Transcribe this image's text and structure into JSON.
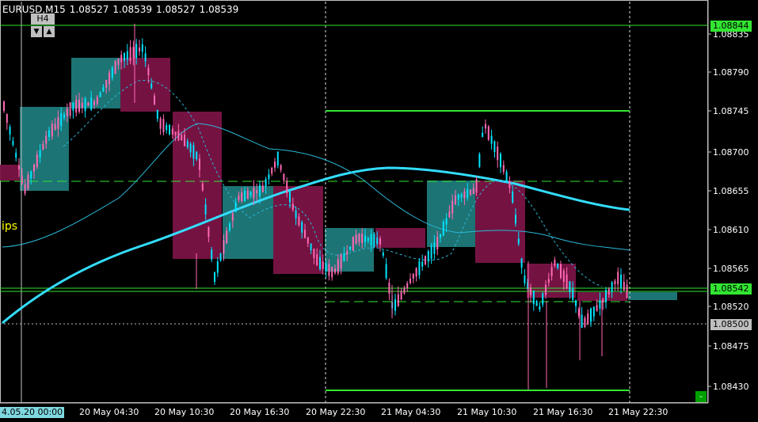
{
  "header": {
    "symbol": "EURUSD,M15",
    "open": "1.08527",
    "high": "1.08539",
    "low": "1.08527",
    "close": "1.08539"
  },
  "timeframe_widget": {
    "label": "H4",
    "down_glyph": "▼",
    "up_glyph": "▲"
  },
  "indicator_label": "ips",
  "price_axis": {
    "ticks": [
      "1.08835",
      "1.08790",
      "1.08745",
      "1.08700",
      "1.08655",
      "1.08610",
      "1.08565",
      "1.08520",
      "1.08475",
      "1.08430"
    ],
    "green_marker": "1.08844",
    "green_marker2": "1.08542",
    "gray_marker": "1.08500"
  },
  "time_axis": {
    "first": "4.05.20 00:00",
    "labels": [
      "20 May 04:30",
      "20 May 10:30",
      "20 May 16:30",
      "20 May 22:30",
      "21 May 04:30",
      "21 May 10:30",
      "21 May 16:30",
      "21 May 22:30"
    ]
  },
  "minus_button": "-",
  "colors": {
    "bull": "#00e5ff",
    "bear": "#ff69b4",
    "box_bull": "#1f7a7a",
    "box_bear": "#7a1446",
    "level": "#32e632",
    "ma_thick": "#33ddff",
    "ma_thin": "#2ab8d8",
    "background": "#000000"
  }
}
